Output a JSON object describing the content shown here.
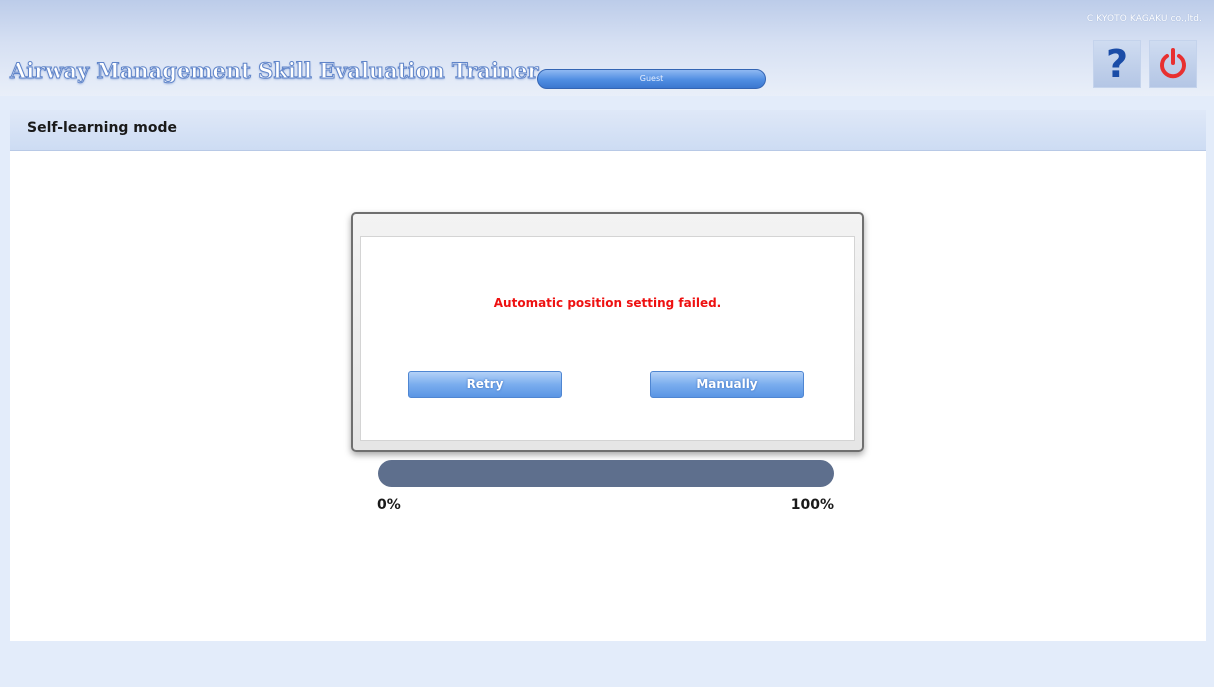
{
  "header": {
    "copyright": "C KYOTO KAGAKU co.,ltd.",
    "app_title": "Airway Management Skill Evaluation Trainer",
    "user_label": "Guest",
    "help_icon": "question-mark-icon",
    "power_icon": "power-icon"
  },
  "mode_bar": {
    "title": "Self-learning mode"
  },
  "dialog": {
    "message": "Automatic position setting failed.",
    "retry_label": "Retry",
    "manually_label": "Manually"
  },
  "progress": {
    "value_fraction": 0.0,
    "min_label": "0%",
    "max_label": "100%"
  },
  "colors": {
    "error_text": "#ee1111",
    "accent_blue": "#5a95e4",
    "power_red": "#e83030",
    "help_blue": "#1a4ca7",
    "progress_track": "#5e6f8d"
  }
}
